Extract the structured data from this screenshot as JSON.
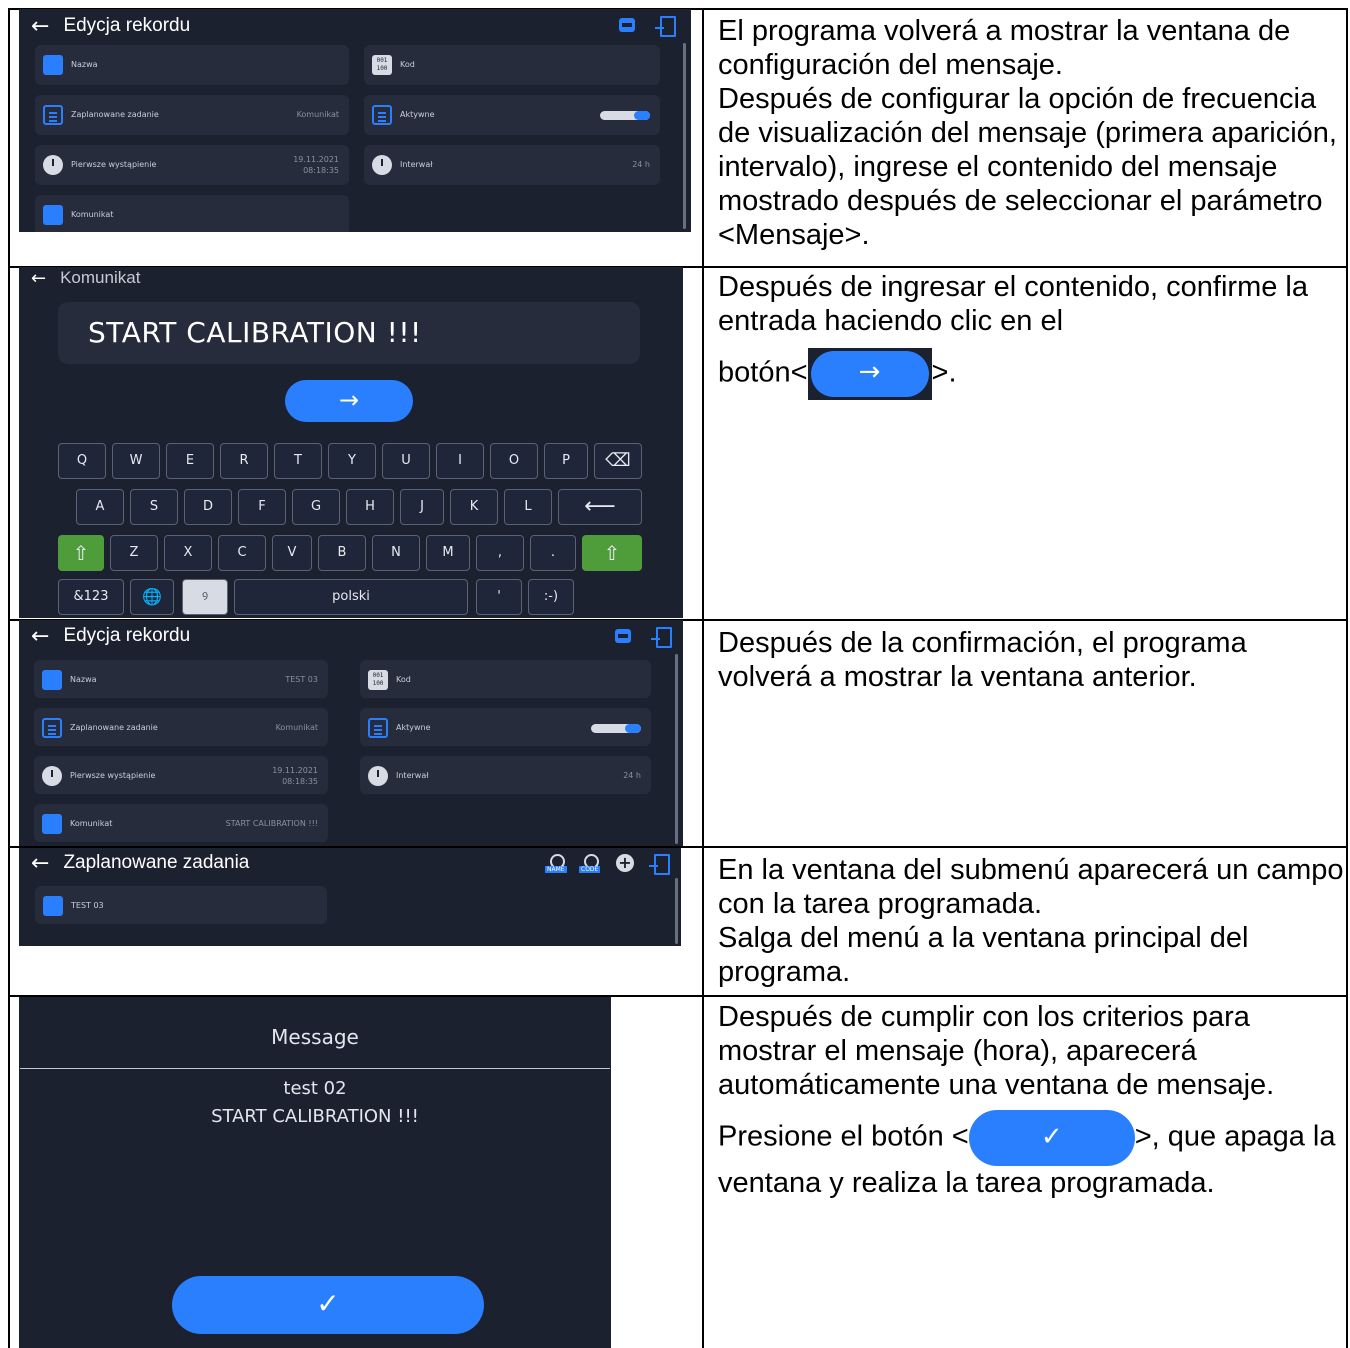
{
  "screen1": {
    "title": "Edycja rekordu",
    "fields": [
      {
        "label": "Nazwa",
        "value": ""
      },
      {
        "label": "Kod",
        "value": ""
      },
      {
        "label": "Zaplanowane zadanie",
        "value": "Komunikat"
      },
      {
        "label": "Aktywne",
        "value": ""
      },
      {
        "label": "Pierwsze wystąpienie",
        "value": "19.11.2021",
        "value2": "08:18:35"
      },
      {
        "label": "Interwał",
        "value": "24 h"
      },
      {
        "label": "Komunikat",
        "value": ""
      }
    ]
  },
  "text1": [
    "El programa volverá a mostrar la ventana de configuración del mensaje.",
    "Después de configurar la opción de frecuencia de visualización del mensaje (primera aparición, intervalo), ingrese el contenido del mensaje mostrado después de seleccionar el parámetro <Mensaje>."
  ],
  "screen2": {
    "title": "Komunikat",
    "input_value": "START CALIBRATION !!!",
    "enter_label": "→",
    "row1": [
      "Q",
      "W",
      "E",
      "R",
      "T",
      "Y",
      "U",
      "I",
      "O",
      "P"
    ],
    "row2": [
      "A",
      "S",
      "D",
      "F",
      "G",
      "H",
      "J",
      "K",
      "L"
    ],
    "row3": [
      "Z",
      "X",
      "C",
      "V",
      "B",
      "N",
      "M",
      ",",
      "."
    ],
    "row4": {
      "sym": "&123",
      "space": "polski",
      "apostrophe": "'",
      "smiley": ":-)"
    },
    "backspace": "⌫",
    "return": "⟵",
    "shift": "⇧",
    "globe": "🌐",
    "handwrite": "ꝰ"
  },
  "text2": {
    "line1": "Después de ingresar el contenido, confirme la entrada haciendo clic en el",
    "prefix": "botón<",
    "button": "→",
    "suffix": ">."
  },
  "screen3": {
    "title": "Edycja rekordu",
    "fields": [
      {
        "label": "Nazwa",
        "value": "TEST 03"
      },
      {
        "label": "Kod",
        "value": ""
      },
      {
        "label": "Zaplanowane zadanie",
        "value": "Komunikat"
      },
      {
        "label": "Aktywne",
        "value": ""
      },
      {
        "label": "Pierwsze wystąpienie",
        "value": "19.11.2021",
        "value2": "08:18:35"
      },
      {
        "label": "Interwał",
        "value": "24 h"
      },
      {
        "label": "Komunikat",
        "value": "START CALIBRATION !!!"
      }
    ]
  },
  "text3": "Después de la confirmación, el programa volverá a mostrar la ventana anterior.",
  "screen4": {
    "title": "Zaplanowane zadania",
    "item": "TEST 03",
    "icon_tags": [
      "NAME",
      "CODE"
    ]
  },
  "text4": [
    "En la ventana del submenú aparecerá un campo con la tarea programada.",
    "Salga del menú a la ventana principal del programa."
  ],
  "screen5": {
    "title": "Message",
    "line1": "test 02",
    "line2": "START CALIBRATION !!!",
    "ok_label": "✓"
  },
  "text5": {
    "para1": "Después de cumplir con los criterios para mostrar el mensaje (hora), aparecerá automáticamente una ventana de mensaje.",
    "prefix": "Presione el botón <",
    "button": "✓",
    "suffix": ">, que apaga la ventana y realiza la tarea programada."
  },
  "colors": {
    "panel": "#1c2130",
    "field": "#262c3c",
    "accent": "#2a7fff",
    "shift": "#4f9d3a"
  }
}
